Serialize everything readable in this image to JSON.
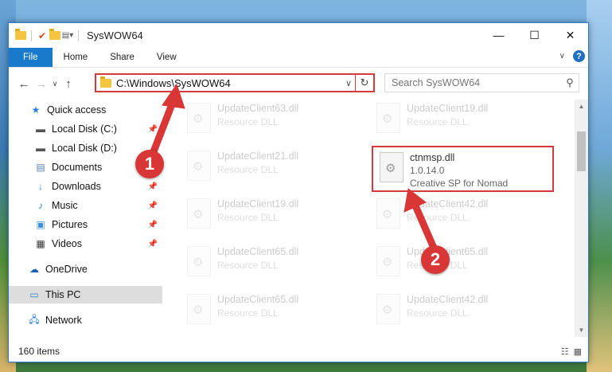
{
  "window": {
    "title": "SysWOW64",
    "controls": {
      "minimize": "—",
      "maximize": "☐",
      "close": "✕"
    }
  },
  "ribbon": {
    "tabs": [
      "File",
      "Home",
      "Share",
      "View"
    ],
    "help": "?"
  },
  "address": {
    "path": "C:\\Windows\\SysWOW64",
    "search_placeholder": "Search SysWOW64"
  },
  "sidebar": {
    "items": [
      {
        "label": "Quick access",
        "icon": "star-icon"
      },
      {
        "label": "Local Disk (C:)",
        "icon": "drive-icon",
        "pinned": true
      },
      {
        "label": "Local Disk (D:)",
        "icon": "drive-icon"
      },
      {
        "label": "Documents",
        "icon": "documents-icon",
        "pinned": true
      },
      {
        "label": "Downloads",
        "icon": "downloads-icon",
        "pinned": true
      },
      {
        "label": "Music",
        "icon": "music-icon",
        "pinned": true
      },
      {
        "label": "Pictures",
        "icon": "pictures-icon",
        "pinned": true
      },
      {
        "label": "Videos",
        "icon": "videos-icon",
        "pinned": true
      },
      {
        "label": "OneDrive",
        "icon": "onedrive-icon"
      },
      {
        "label": "This PC",
        "icon": "pc-icon",
        "selected": true
      },
      {
        "label": "Network",
        "icon": "network-icon"
      }
    ]
  },
  "files": [
    {
      "name": "UpdateClient63.dll",
      "desc": "Resource DLL"
    },
    {
      "name": "UpdateClient19.dll",
      "desc": "Resource DLL"
    },
    {
      "name": "UpdateClient21.dll",
      "desc": "Resource DLL"
    },
    {
      "name": "ctnmsp.dll",
      "version": "1.0.14.0",
      "desc": "Creative SP for Nomad",
      "highlighted": true
    },
    {
      "name": "UpdateClient19.dll",
      "desc": "Resource DLL"
    },
    {
      "name": "UpdateClient42.dll",
      "desc": "Resource DLL"
    },
    {
      "name": "UpdateClient65.dll",
      "desc": "Resource DLL"
    },
    {
      "name": "UpdateClient65.dll",
      "desc": "Resource DLL"
    },
    {
      "name": "UpdateClient65.dll",
      "desc": "Resource DLL"
    },
    {
      "name": "UpdateClient42.dll",
      "desc": "Resource DLL"
    }
  ],
  "status": {
    "count": "160 items"
  },
  "callouts": [
    "1",
    "2"
  ],
  "colors": {
    "accent": "#1979ca",
    "highlight": "#d73a3a"
  }
}
